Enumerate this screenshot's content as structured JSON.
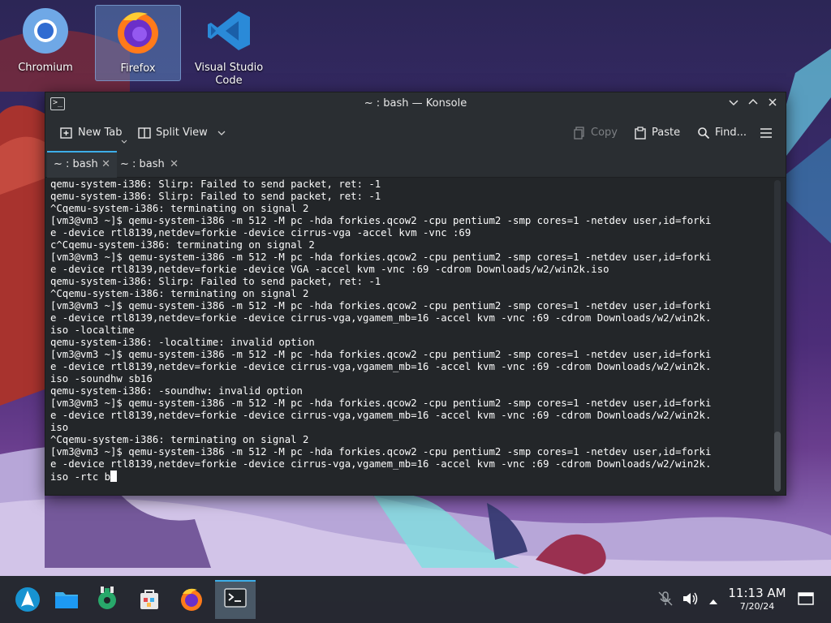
{
  "desktop": {
    "icons": [
      {
        "label": "Chromium",
        "icon": "chromium-icon"
      },
      {
        "label": "Firefox",
        "icon": "firefox-icon"
      },
      {
        "label": "Visual Studio Code",
        "icon": "vscode-icon"
      }
    ]
  },
  "window": {
    "title": "~ : bash — Konsole",
    "toolbar": {
      "new_tab": "New Tab",
      "split_view": "Split View",
      "copy": "Copy",
      "paste": "Paste",
      "find": "Find..."
    },
    "tabs": [
      {
        "label": "~ : bash",
        "active": true
      },
      {
        "label": "~ : bash",
        "active": false
      }
    ],
    "terminal_lines": [
      "qemu-system-i386: Slirp: Failed to send packet, ret: -1",
      "qemu-system-i386: Slirp: Failed to send packet, ret: -1",
      "^Cqemu-system-i386: terminating on signal 2",
      "[vm3@vm3 ~]$ qemu-system-i386 -m 512 -M pc -hda forkies.qcow2 -cpu pentium2 -smp cores=1 -netdev user,id=forki",
      "e -device rtl8139,netdev=forkie -device cirrus-vga -accel kvm -vnc :69",
      "c^Cqemu-system-i386: terminating on signal 2",
      "[vm3@vm3 ~]$ qemu-system-i386 -m 512 -M pc -hda forkies.qcow2 -cpu pentium2 -smp cores=1 -netdev user,id=forki",
      "e -device rtl8139,netdev=forkie -device VGA -accel kvm -vnc :69 -cdrom Downloads/w2/win2k.iso",
      "qemu-system-i386: Slirp: Failed to send packet, ret: -1",
      "^Cqemu-system-i386: terminating on signal 2",
      "[vm3@vm3 ~]$ qemu-system-i386 -m 512 -M pc -hda forkies.qcow2 -cpu pentium2 -smp cores=1 -netdev user,id=forki",
      "e -device rtl8139,netdev=forkie -device cirrus-vga,vgamem_mb=16 -accel kvm -vnc :69 -cdrom Downloads/w2/win2k.",
      "iso -localtime",
      "qemu-system-i386: -localtime: invalid option",
      "[vm3@vm3 ~]$ qemu-system-i386 -m 512 -M pc -hda forkies.qcow2 -cpu pentium2 -smp cores=1 -netdev user,id=forki",
      "e -device rtl8139,netdev=forkie -device cirrus-vga,vgamem_mb=16 -accel kvm -vnc :69 -cdrom Downloads/w2/win2k.",
      "iso -soundhw sb16",
      "qemu-system-i386: -soundhw: invalid option",
      "[vm3@vm3 ~]$ qemu-system-i386 -m 512 -M pc -hda forkies.qcow2 -cpu pentium2 -smp cores=1 -netdev user,id=forki",
      "e -device rtl8139,netdev=forkie -device cirrus-vga,vgamem_mb=16 -accel kvm -vnc :69 -cdrom Downloads/w2/win2k.",
      "iso",
      "^Cqemu-system-i386: terminating on signal 2",
      "[vm3@vm3 ~]$ qemu-system-i386 -m 512 -M pc -hda forkies.qcow2 -cpu pentium2 -smp cores=1 -netdev user,id=forki",
      "e -device rtl8139,netdev=forkie -device cirrus-vga,vgamem_mb=16 -accel kvm -vnc :69 -cdrom Downloads/w2/win2k.",
      "iso -rtc b"
    ]
  },
  "taskbar": {
    "items": [
      "application-launcher-icon",
      "file-manager-icon",
      "system-settings-icon",
      "discover-icon",
      "firefox-icon",
      "konsole-icon"
    ],
    "clock": "11:13 AM",
    "date": "7/20/24"
  },
  "colors": {
    "accent": "#3daee9",
    "terminal_bg": "#232629",
    "terminal_fg": "#fcfcfc"
  }
}
